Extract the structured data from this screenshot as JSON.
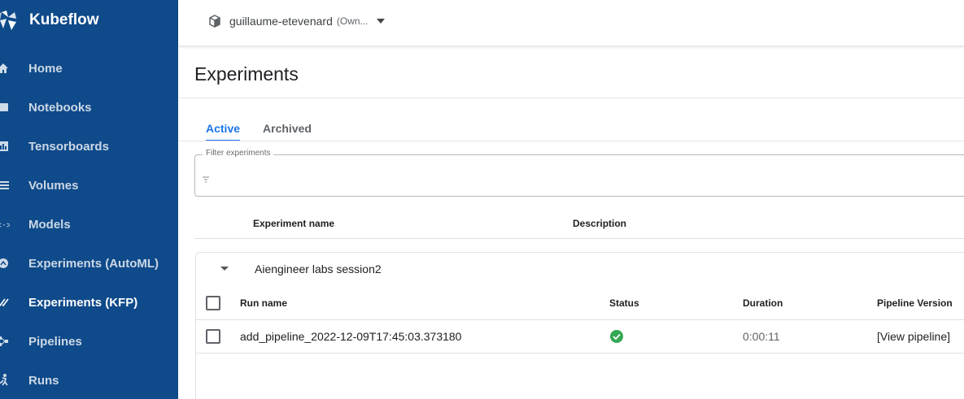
{
  "brand": {
    "name": "Kubeflow"
  },
  "sidebar": {
    "items": [
      {
        "label": "Home",
        "icon": "home-icon"
      },
      {
        "label": "Notebooks",
        "icon": "notebook-icon"
      },
      {
        "label": "Tensorboards",
        "icon": "chart-icon"
      },
      {
        "label": "Volumes",
        "icon": "storage-icon"
      },
      {
        "label": "Models",
        "icon": "models-icon"
      },
      {
        "label": "Experiments (AutoML)",
        "icon": "automl-icon"
      },
      {
        "label": "Experiments (KFP)",
        "icon": "done-all-icon",
        "active": true
      },
      {
        "label": "Pipelines",
        "icon": "pipeline-icon"
      },
      {
        "label": "Runs",
        "icon": "runner-icon"
      }
    ]
  },
  "namespace": {
    "name": "guillaume-etevenard",
    "role": "(Own..."
  },
  "page": {
    "title": "Experiments"
  },
  "tabs": [
    {
      "label": "Active",
      "active": true
    },
    {
      "label": "Archived",
      "active": false
    }
  ],
  "filter": {
    "legend": "Filter experiments",
    "value": ""
  },
  "columns": {
    "experiment_name": "Experiment name",
    "description": "Description"
  },
  "experiment": {
    "name": "Aiengineer labs session2",
    "run_columns": {
      "run_name": "Run name",
      "status": "Status",
      "duration": "Duration",
      "pipeline_version": "Pipeline Version"
    },
    "runs": [
      {
        "name": "add_pipeline_2022-12-09T17:45:03.373180",
        "status": "succeeded",
        "duration": "0:00:11",
        "pipeline_version": "[View pipeline]"
      }
    ]
  },
  "colors": {
    "sidebar_bg": "#0f4a8a",
    "accent": "#1a73e8",
    "success": "#34a853"
  }
}
